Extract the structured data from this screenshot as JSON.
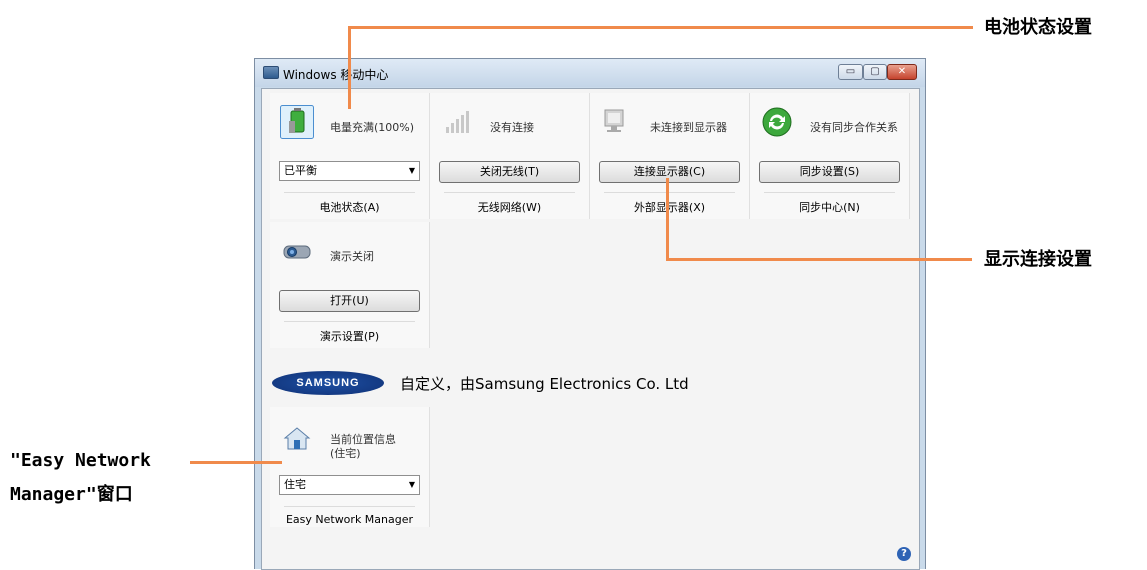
{
  "window": {
    "title": "Windows 移动中心",
    "min_glyph": "▭",
    "max_glyph": "▢",
    "close_glyph": "✕"
  },
  "tiles": {
    "battery": {
      "label": "电量充满(100%)",
      "select_value": "已平衡",
      "footer": "电池状态(A)"
    },
    "wireless": {
      "label": "没有连接",
      "button": "关闭无线(T)",
      "footer": "无线网络(W)"
    },
    "display": {
      "label": "未连接到显示器",
      "button": "连接显示器(C)",
      "footer": "外部显示器(X)"
    },
    "sync": {
      "label": "没有同步合作关系",
      "button": "同步设置(S)",
      "footer": "同步中心(N)"
    },
    "presentation": {
      "label": "演示关闭",
      "button": "打开(U)",
      "footer": "演示设置(P)"
    },
    "location": {
      "label_line1": "当前位置信息",
      "label_line2": "(住宅)",
      "select_value": "住宅",
      "footer": "Easy Network Manager"
    }
  },
  "samsung": {
    "logo_text": "SAMSUNG",
    "custom_text": "自定义，由Samsung Electronics Co. Ltd"
  },
  "help_glyph": "?",
  "callouts": {
    "battery": "电池状态设置",
    "display": "显示连接设置",
    "enm_line1": "\"Easy Network",
    "enm_line2": "Manager\"窗口"
  },
  "colors": {
    "callout_line": "#f08a4b",
    "window_frame": "#c9daea",
    "client_bg": "#f4f4f4"
  }
}
